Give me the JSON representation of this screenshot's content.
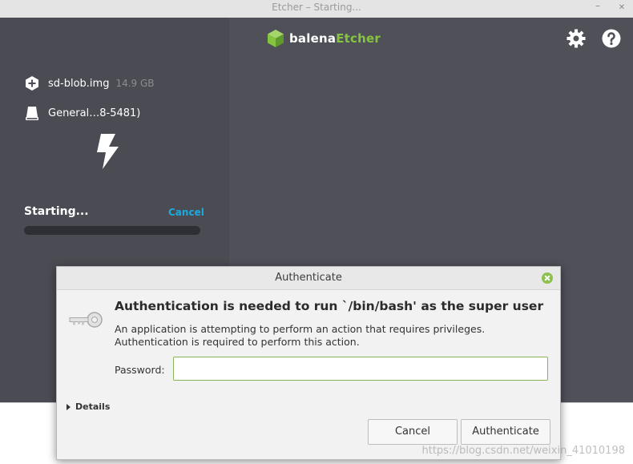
{
  "window": {
    "title": "Etcher – Starting...",
    "minimize_glyph": "–",
    "close_glyph": "✕"
  },
  "app": {
    "logo": {
      "prefix": "balena",
      "suffix": "Etcher",
      "accent_color": "#85c441"
    },
    "icons": {
      "settings": "gear-icon",
      "help": "help-icon"
    },
    "image": {
      "name": "sd-blob.img",
      "size": "14.9 GB",
      "icon": "plus-hex-icon"
    },
    "drive": {
      "name": "General…8-5481)",
      "icon": "drive-icon"
    },
    "flash_icon": "lightning-icon",
    "status": "Starting...",
    "cancel_label": "Cancel",
    "progress_fraction": 0.0
  },
  "dialog": {
    "title": "Authenticate",
    "heading": "Authentication is needed to run `/bin/bash' as the super user",
    "message": "An application is attempting to perform an action that requires privileges. Authentication is required to perform this action.",
    "password_label": "Password:",
    "password_value": "",
    "details_label": "Details",
    "cancel_label": "Cancel",
    "authenticate_label": "Authenticate",
    "icon": "key-icon"
  },
  "watermark": "https://blog.csdn.net/weixin_41010198"
}
